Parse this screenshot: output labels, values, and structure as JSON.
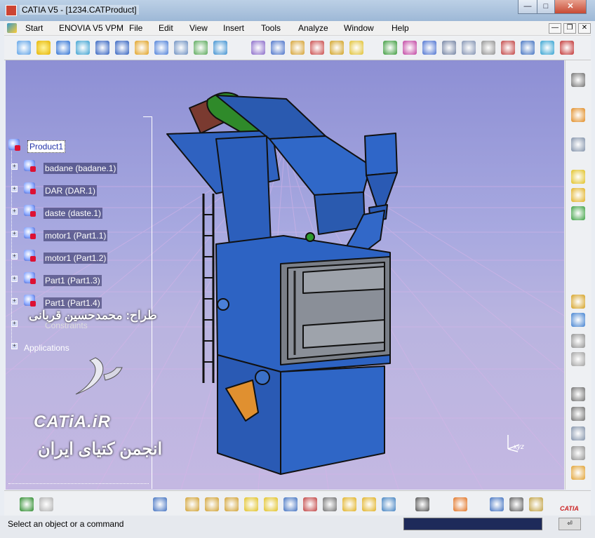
{
  "window": {
    "title": "CATIA V5 - [1234.CATProduct]",
    "controls": {
      "minimize": "—",
      "maximize": "□",
      "close": "✕"
    }
  },
  "menubar": {
    "items": [
      "Start",
      "ENOVIA V5 VPM",
      "File",
      "Edit",
      "View",
      "Insert",
      "Tools",
      "Analyze",
      "Window",
      "Help"
    ],
    "mdi": {
      "minimize": "—",
      "restore": "❐",
      "close": "✕"
    }
  },
  "toolbar_top": {
    "icons": [
      "fly-mode-icon",
      "fit-all-icon",
      "pan-icon",
      "rotate-icon",
      "zoom-in-icon",
      "zoom-out-icon",
      "normal-view-icon",
      "iso-view-icon",
      "hide-show-icon",
      "swap-space-icon",
      "shading-icon",
      "catalog-icon",
      "product-explode-icon",
      "manipulate-icon",
      "snap-icon",
      "smart-move-icon",
      "constraint-icon",
      "fix-icon",
      "contact-icon",
      "offset-icon",
      "angle-icon",
      "update-icon",
      "multi-instantiate-icon",
      "reuse-pattern-icon",
      "bill-of-material-icon",
      "scene-icon",
      "measure-icon"
    ]
  },
  "tree": {
    "root": "Product1",
    "children": [
      "badane (badane.1)",
      "DAR (DAR.1)",
      "daste (daste.1)",
      "motor1 (Part1.1)",
      "motor1 (Part1.2)",
      "Part1 (Part1.3)",
      "Part1 (Part1.4)",
      "Constraints"
    ],
    "applications": "Applications"
  },
  "overlay": {
    "designer": "طراح: محمدحسین قربانی",
    "brand_en": "CATiA.iR",
    "brand_fa": "انجمن کتیای ایران"
  },
  "compass": "xyz",
  "rightbar_icons": [
    "assembly-design-icon",
    "select-icon",
    "component-properties-icon",
    "new-component-icon",
    "new-product-icon",
    "new-part-icon",
    "existing-component-icon",
    "replace-component-icon",
    "graph-tree-icon",
    "generate-numbering-icon",
    "text-annotation-icon",
    "flag-note-icon",
    "view-mode-icon",
    "annotation-plane-icon",
    "sectioning-icon"
  ],
  "bottombar_icons": [
    "undo-icon",
    "redo-icon",
    "update-all-icon",
    "assembly-features-icon",
    "bolt-icon",
    "split-icon",
    "hole-icon",
    "pocket-icon",
    "symmetry-icon",
    "add-icon",
    "remove-icon",
    "scene-browser-icon",
    "weld-icon",
    "capture-icon",
    "grid-icon",
    "sectioning-plane-icon",
    "distance-icon",
    "clash-icon",
    "brand-logo-icon"
  ],
  "brand_logo_text": "CATIA",
  "status": {
    "message": "Select an object or a command",
    "command_input": "",
    "power_input_button": "⏎"
  }
}
